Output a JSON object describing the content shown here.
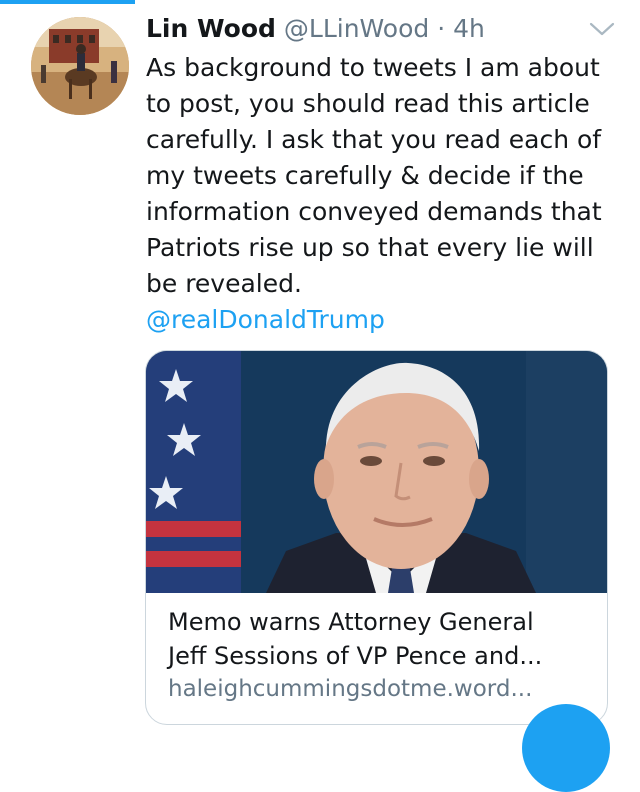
{
  "colors": {
    "accent": "#1da1f2",
    "text_primary": "#14171a",
    "text_secondary": "#657786",
    "border": "#ccd6dd"
  },
  "tweet": {
    "author_name": "Lin Wood",
    "author_handle": "@LLinWood",
    "separator": "·",
    "time": "4h",
    "text": "As background to tweets I am about to post, you should read this article carefully. I ask that you read each of my tweets carefully & decide if the information conveyed demands that Patriots rise up so that every lie will be revealed.",
    "mention": "@realDonaldTrump",
    "menu_icon": "chevron-down-icon",
    "avatar_icon": "avatar-image"
  },
  "card": {
    "title": "Memo warns Attorney General\nJeff Sessions of VP Pence and...",
    "domain": "haleighcummingsdotme.word..."
  },
  "compose_button": {
    "icon": "compose-icon"
  }
}
